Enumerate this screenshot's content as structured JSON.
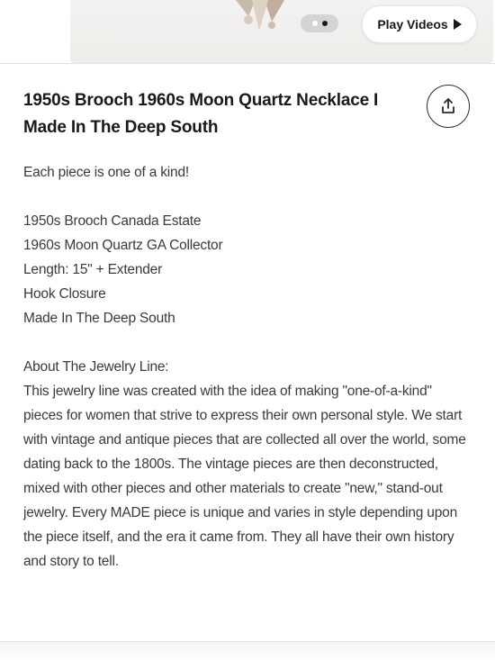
{
  "media": {
    "play_videos_label": "Play Videos",
    "carousel_total": 2,
    "carousel_active_index": 1
  },
  "listing": {
    "title": "1950s Brooch 1960s Moon Quartz Necklace I Made In The Deep South",
    "description": {
      "intro": "Each piece is one of a kind!",
      "details": [
        "1950s Brooch Canada Estate",
        "1960s Moon Quartz GA Collector",
        "Length: 15\" + Extender",
        "Hook Closure",
        "Made In The Deep South"
      ],
      "about_heading": "About The Jewelry Line:",
      "about_text": "This jewelry line was created with the idea of making \"one-of-a-kind\" pieces for women that strive to express their own personal style. We start with vintage and antique pieces that are collected all over the world, some dating back to the 1800s. The vintage pieces are then deconstructed, mixed with other pieces and other materials to create \"new,\" stand-out jewelry. Every MADE piece is unique and varies in style depending upon the piece itself, and the era it came from. They all have their own history and story to tell."
    }
  },
  "icons": {
    "share": "share-icon",
    "play": "play-icon"
  },
  "colors": {
    "text_primary": "#191919",
    "text_body": "#3a3a3a",
    "divider": "#e4e4e4"
  }
}
